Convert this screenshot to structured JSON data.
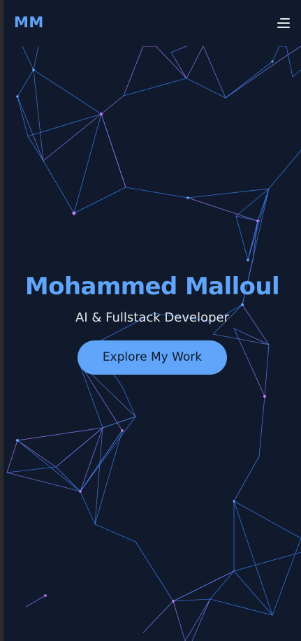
{
  "header": {
    "logo": "MM"
  },
  "hero": {
    "title": "Mohammed Malloul",
    "subtitle": "AI & Fullstack Developer",
    "cta_label": "Explore My Work"
  },
  "colors": {
    "background": "#101a2c",
    "accent": "#60a5fa",
    "node_pink": "#c77dff",
    "text_light": "#e5e7eb"
  },
  "icons": {
    "menu": "hamburger-menu-icon"
  }
}
